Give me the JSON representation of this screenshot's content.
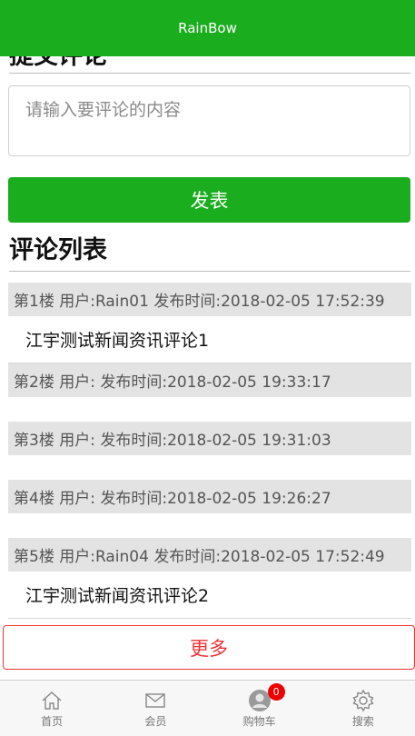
{
  "header": {
    "title": "RainBow"
  },
  "submit": {
    "title": "提交评论",
    "placeholder": "请输入要评论的内容",
    "publish_label": "发表"
  },
  "list": {
    "title": "评论列表",
    "comments": [
      {
        "head": "第1楼 用户:Rain01 发布时间:2018-02-05 17:52:39",
        "body": "江宇测试新闻资讯评论1"
      },
      {
        "head": "第2楼 用户: 发布时间:2018-02-05 19:33:17",
        "body": ""
      },
      {
        "head": "第3楼 用户: 发布时间:2018-02-05 19:31:03",
        "body": ""
      },
      {
        "head": "第4楼 用户: 发布时间:2018-02-05 19:26:27",
        "body": ""
      },
      {
        "head": "第5楼 用户:Rain04 发布时间:2018-02-05 17:52:49",
        "body": "江宇测试新闻资讯评论2"
      }
    ],
    "more_label": "更多"
  },
  "tabbar": {
    "items": [
      {
        "label": "首页",
        "icon": "home-icon"
      },
      {
        "label": "会员",
        "icon": "mail-icon"
      },
      {
        "label": "购物车",
        "icon": "user-avatar-icon",
        "badge": "0"
      },
      {
        "label": "搜索",
        "icon": "gear-icon"
      }
    ]
  },
  "colors": {
    "brand_green": "#1aad1e",
    "accent_red": "#ee3333"
  }
}
